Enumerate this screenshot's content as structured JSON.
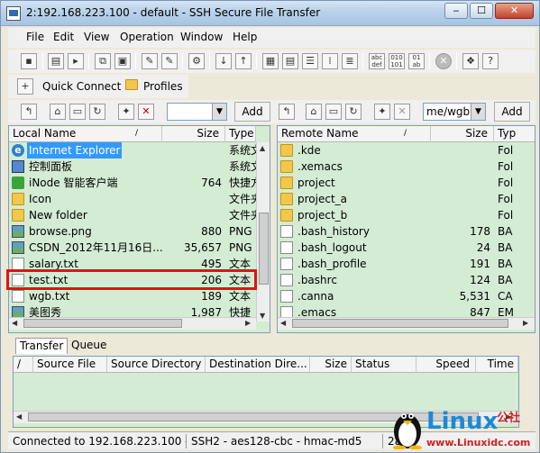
{
  "window": {
    "title": "2:192.168.223.100 - default - SSH Secure File Transfer"
  },
  "menu": [
    "File",
    "Edit",
    "View",
    "Operation",
    "Window",
    "Help"
  ],
  "toolbar": {
    "quick_connect": "Quick Connect",
    "profiles": "Profiles",
    "add_label": "Add"
  },
  "local": {
    "path_value": "",
    "columns": [
      "Local Name",
      "Size",
      "Type"
    ],
    "rows": [
      {
        "name": "Internet Explorer",
        "size": "",
        "type": "系统文",
        "icon": "ie-icon",
        "selected": true
      },
      {
        "name": "控制面板",
        "size": "",
        "type": "系统文",
        "icon": "control-panel-icon"
      },
      {
        "name": "iNode 智能客户端",
        "size": "764",
        "type": "快捷方",
        "icon": "inode-icon"
      },
      {
        "name": "Icon",
        "size": "",
        "type": "文件夹",
        "icon": "folder-icon"
      },
      {
        "name": "New folder",
        "size": "",
        "type": "文件夹",
        "icon": "folder-icon"
      },
      {
        "name": "browse.png",
        "size": "880",
        "type": "PNG",
        "icon": "image-icon"
      },
      {
        "name": "CSDN_2012年11月16日...",
        "size": "35,657",
        "type": "PNG",
        "icon": "image-icon"
      },
      {
        "name": "salary.txt",
        "size": "495",
        "type": "文本",
        "icon": "text-file-icon"
      },
      {
        "name": "test.txt",
        "size": "206",
        "type": "文本",
        "icon": "text-file-icon"
      },
      {
        "name": "wgb.txt",
        "size": "189",
        "type": "文本",
        "icon": "text-file-icon"
      },
      {
        "name": "美图秀",
        "size": "1,987",
        "type": "快捷",
        "icon": "shortcut-icon"
      }
    ]
  },
  "remote": {
    "path_value": "me/wgb",
    "columns": [
      "Remote Name",
      "Size",
      "Typ"
    ],
    "rows": [
      {
        "name": ".kde",
        "size": "",
        "type": "Fol",
        "icon": "folder-icon"
      },
      {
        "name": ".xemacs",
        "size": "",
        "type": "Fol",
        "icon": "folder-icon"
      },
      {
        "name": "project",
        "size": "",
        "type": "Fol",
        "icon": "folder-icon"
      },
      {
        "name": "project_a",
        "size": "",
        "type": "Fol",
        "icon": "folder-icon"
      },
      {
        "name": "project_b",
        "size": "",
        "type": "Fol",
        "icon": "folder-icon"
      },
      {
        "name": ".bash_history",
        "size": "178",
        "type": "BA",
        "icon": "file-icon"
      },
      {
        "name": ".bash_logout",
        "size": "24",
        "type": "BA",
        "icon": "file-icon"
      },
      {
        "name": ".bash_profile",
        "size": "191",
        "type": "BA",
        "icon": "file-icon"
      },
      {
        "name": ".bashrc",
        "size": "124",
        "type": "BA",
        "icon": "file-icon"
      },
      {
        "name": ".canna",
        "size": "5,531",
        "type": "CA",
        "icon": "file-icon"
      },
      {
        "name": ".emacs",
        "size": "847",
        "type": "EM",
        "icon": "file-icon"
      }
    ]
  },
  "transfer": {
    "tabs": [
      "Transfer",
      "Queue"
    ],
    "columns": [
      "Source File",
      "Source Directory",
      "Destination Dire...",
      "Size",
      "Status",
      "Speed",
      "Time"
    ]
  },
  "status": {
    "connected": "Connected to 192.168.223.100 - /",
    "cipher": "SSH2 - aes128-cbc - hmac-md5",
    "items": "28 i"
  },
  "watermark": {
    "text": "Linux",
    "sub": "公社",
    "url": "www.Linuxidc.com"
  },
  "colors": {
    "pane_bg": "#d4ecd4",
    "selected": "#3399ff",
    "highlight_box": "#e21212"
  }
}
